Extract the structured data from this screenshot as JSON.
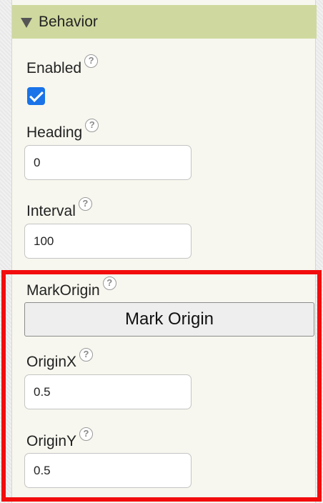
{
  "section": {
    "title": "Behavior",
    "icon": "triangle-down-icon"
  },
  "properties": {
    "enabled": {
      "label": "Enabled",
      "checked": true
    },
    "heading": {
      "label": "Heading",
      "value": "0"
    },
    "interval": {
      "label": "Interval",
      "value": "100"
    },
    "mark_origin": {
      "label": "MarkOrigin",
      "button_label": "Mark Origin"
    },
    "origin_x": {
      "label": "OriginX",
      "value": "0.5"
    },
    "origin_y": {
      "label": "OriginY",
      "value": "0.5"
    }
  },
  "help_glyph": "?",
  "colors": {
    "section_header_bg": "#cfd99f",
    "panel_bg": "#f7f7ef",
    "checkbox_blue": "#1a73e8",
    "highlight_red": "#f20c0c"
  }
}
